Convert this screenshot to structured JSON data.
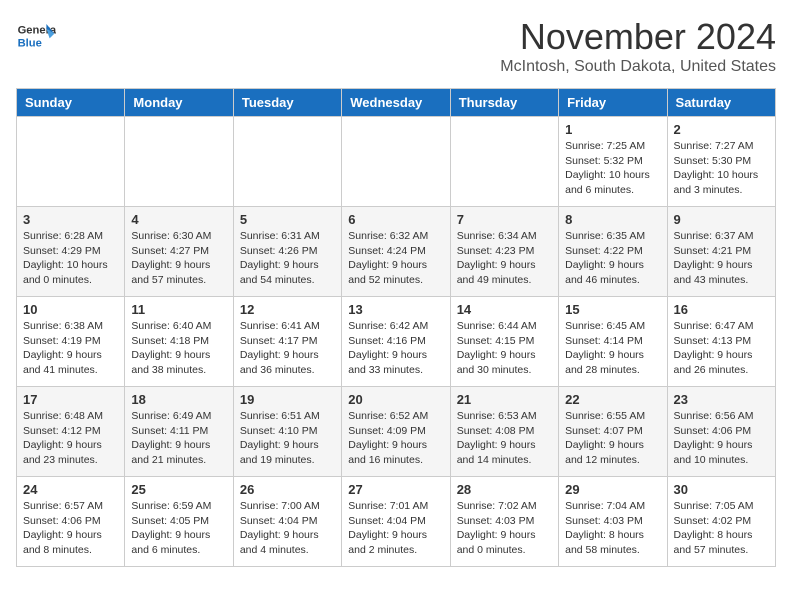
{
  "header": {
    "logo_line1": "General",
    "logo_line2": "Blue",
    "month": "November 2024",
    "location": "McIntosh, South Dakota, United States"
  },
  "weekdays": [
    "Sunday",
    "Monday",
    "Tuesday",
    "Wednesday",
    "Thursday",
    "Friday",
    "Saturday"
  ],
  "weeks": [
    [
      {
        "day": "",
        "info": ""
      },
      {
        "day": "",
        "info": ""
      },
      {
        "day": "",
        "info": ""
      },
      {
        "day": "",
        "info": ""
      },
      {
        "day": "",
        "info": ""
      },
      {
        "day": "1",
        "info": "Sunrise: 7:25 AM\nSunset: 5:32 PM\nDaylight: 10 hours\nand 6 minutes."
      },
      {
        "day": "2",
        "info": "Sunrise: 7:27 AM\nSunset: 5:30 PM\nDaylight: 10 hours\nand 3 minutes."
      }
    ],
    [
      {
        "day": "3",
        "info": "Sunrise: 6:28 AM\nSunset: 4:29 PM\nDaylight: 10 hours\nand 0 minutes."
      },
      {
        "day": "4",
        "info": "Sunrise: 6:30 AM\nSunset: 4:27 PM\nDaylight: 9 hours\nand 57 minutes."
      },
      {
        "day": "5",
        "info": "Sunrise: 6:31 AM\nSunset: 4:26 PM\nDaylight: 9 hours\nand 54 minutes."
      },
      {
        "day": "6",
        "info": "Sunrise: 6:32 AM\nSunset: 4:24 PM\nDaylight: 9 hours\nand 52 minutes."
      },
      {
        "day": "7",
        "info": "Sunrise: 6:34 AM\nSunset: 4:23 PM\nDaylight: 9 hours\nand 49 minutes."
      },
      {
        "day": "8",
        "info": "Sunrise: 6:35 AM\nSunset: 4:22 PM\nDaylight: 9 hours\nand 46 minutes."
      },
      {
        "day": "9",
        "info": "Sunrise: 6:37 AM\nSunset: 4:21 PM\nDaylight: 9 hours\nand 43 minutes."
      }
    ],
    [
      {
        "day": "10",
        "info": "Sunrise: 6:38 AM\nSunset: 4:19 PM\nDaylight: 9 hours\nand 41 minutes."
      },
      {
        "day": "11",
        "info": "Sunrise: 6:40 AM\nSunset: 4:18 PM\nDaylight: 9 hours\nand 38 minutes."
      },
      {
        "day": "12",
        "info": "Sunrise: 6:41 AM\nSunset: 4:17 PM\nDaylight: 9 hours\nand 36 minutes."
      },
      {
        "day": "13",
        "info": "Sunrise: 6:42 AM\nSunset: 4:16 PM\nDaylight: 9 hours\nand 33 minutes."
      },
      {
        "day": "14",
        "info": "Sunrise: 6:44 AM\nSunset: 4:15 PM\nDaylight: 9 hours\nand 30 minutes."
      },
      {
        "day": "15",
        "info": "Sunrise: 6:45 AM\nSunset: 4:14 PM\nDaylight: 9 hours\nand 28 minutes."
      },
      {
        "day": "16",
        "info": "Sunrise: 6:47 AM\nSunset: 4:13 PM\nDaylight: 9 hours\nand 26 minutes."
      }
    ],
    [
      {
        "day": "17",
        "info": "Sunrise: 6:48 AM\nSunset: 4:12 PM\nDaylight: 9 hours\nand 23 minutes."
      },
      {
        "day": "18",
        "info": "Sunrise: 6:49 AM\nSunset: 4:11 PM\nDaylight: 9 hours\nand 21 minutes."
      },
      {
        "day": "19",
        "info": "Sunrise: 6:51 AM\nSunset: 4:10 PM\nDaylight: 9 hours\nand 19 minutes."
      },
      {
        "day": "20",
        "info": "Sunrise: 6:52 AM\nSunset: 4:09 PM\nDaylight: 9 hours\nand 16 minutes."
      },
      {
        "day": "21",
        "info": "Sunrise: 6:53 AM\nSunset: 4:08 PM\nDaylight: 9 hours\nand 14 minutes."
      },
      {
        "day": "22",
        "info": "Sunrise: 6:55 AM\nSunset: 4:07 PM\nDaylight: 9 hours\nand 12 minutes."
      },
      {
        "day": "23",
        "info": "Sunrise: 6:56 AM\nSunset: 4:06 PM\nDaylight: 9 hours\nand 10 minutes."
      }
    ],
    [
      {
        "day": "24",
        "info": "Sunrise: 6:57 AM\nSunset: 4:06 PM\nDaylight: 9 hours\nand 8 minutes."
      },
      {
        "day": "25",
        "info": "Sunrise: 6:59 AM\nSunset: 4:05 PM\nDaylight: 9 hours\nand 6 minutes."
      },
      {
        "day": "26",
        "info": "Sunrise: 7:00 AM\nSunset: 4:04 PM\nDaylight: 9 hours\nand 4 minutes."
      },
      {
        "day": "27",
        "info": "Sunrise: 7:01 AM\nSunset: 4:04 PM\nDaylight: 9 hours\nand 2 minutes."
      },
      {
        "day": "28",
        "info": "Sunrise: 7:02 AM\nSunset: 4:03 PM\nDaylight: 9 hours\nand 0 minutes."
      },
      {
        "day": "29",
        "info": "Sunrise: 7:04 AM\nSunset: 4:03 PM\nDaylight: 8 hours\nand 58 minutes."
      },
      {
        "day": "30",
        "info": "Sunrise: 7:05 AM\nSunset: 4:02 PM\nDaylight: 8 hours\nand 57 minutes."
      }
    ]
  ]
}
